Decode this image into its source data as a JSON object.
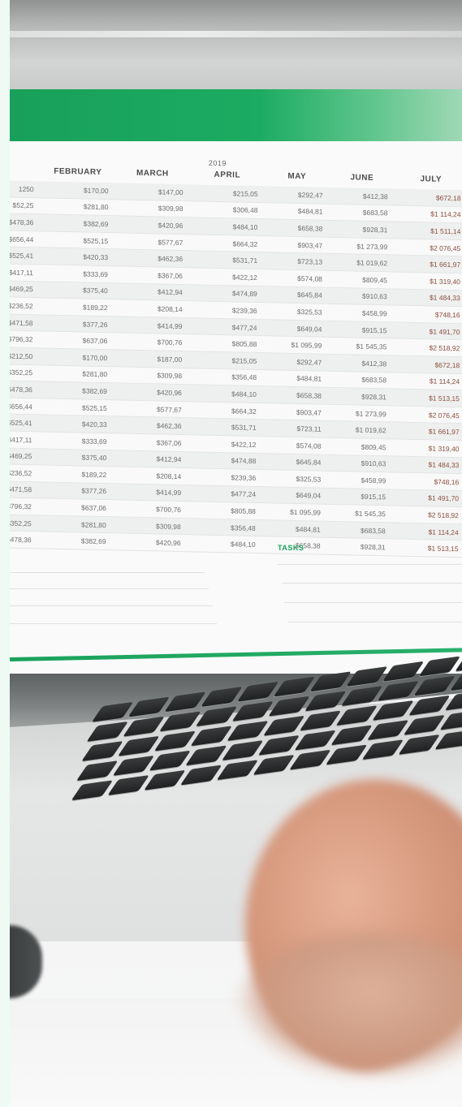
{
  "spreadsheet": {
    "year": "2019",
    "months": [
      "FEBRUARY",
      "MARCH",
      "APRIL",
      "MAY",
      "JUNE",
      "JULY"
    ],
    "rows": [
      [
        "1250",
        "$170,00",
        "$147,00",
        "$215,05",
        "$292,47",
        "$412,38",
        "$672,18"
      ],
      [
        "$52,25",
        "$281,80",
        "$309,98",
        "$306,48",
        "$484,81",
        "$683,58",
        "$1 114,24"
      ],
      [
        "$478,36",
        "$382,69",
        "$420,96",
        "$484,10",
        "$658,38",
        "$928,31",
        "$1 511,14"
      ],
      [
        "$656,44",
        "$525,15",
        "$577,67",
        "$664,32",
        "$903,47",
        "$1 273,99",
        "$2 076,45"
      ],
      [
        "$525,41",
        "$420,33",
        "$462,36",
        "$531,71",
        "$723,13",
        "$1 019,62",
        "$1 661,97"
      ],
      [
        "$417,11",
        "$333,69",
        "$367,06",
        "$422,12",
        "$574,08",
        "$809,45",
        "$1 319,40"
      ],
      [
        "$469,25",
        "$375,40",
        "$412,94",
        "$474,89",
        "$645,84",
        "$910,63",
        "$1 484,33"
      ],
      [
        "$236,52",
        "$189,22",
        "$208,14",
        "$239,36",
        "$325,53",
        "$458,99",
        "$748,16"
      ],
      [
        "$471,58",
        "$377,26",
        "$414,99",
        "$477,24",
        "$649,04",
        "$915,15",
        "$1 491,70"
      ],
      [
        "$796,32",
        "$637,06",
        "$700,76",
        "$805,88",
        "$1 095,99",
        "$1 545,35",
        "$2 518,92"
      ],
      [
        "$212,50",
        "$170,00",
        "$187,00",
        "$215,05",
        "$292,47",
        "$412,38",
        "$672,18"
      ],
      [
        "$352,25",
        "$281,80",
        "$309,98",
        "$356,48",
        "$484,81",
        "$683,58",
        "$1 114,24"
      ],
      [
        "$478,36",
        "$382,69",
        "$420,96",
        "$484,10",
        "$658,38",
        "$928,31",
        "$1 513,15"
      ],
      [
        "$656,44",
        "$525,15",
        "$577,67",
        "$664,32",
        "$903,47",
        "$1 273,99",
        "$2 076,45"
      ],
      [
        "$525,41",
        "$420,33",
        "$462,36",
        "$531,71",
        "$723,11",
        "$1 019,62",
        "$1 661,97"
      ],
      [
        "$417,11",
        "$333,69",
        "$367,06",
        "$422,12",
        "$574,08",
        "$809,45",
        "$1 319,40"
      ],
      [
        "$469,25",
        "$375,40",
        "$412,94",
        "$474,88",
        "$645,84",
        "$910,63",
        "$1 484,33"
      ],
      [
        "$236,52",
        "$189,22",
        "$208,14",
        "$239,36",
        "$325,53",
        "$458,99",
        "$748,16"
      ],
      [
        "$471,58",
        "$377,26",
        "$414,99",
        "$477,24",
        "$649,04",
        "$915,15",
        "$1 491,70"
      ],
      [
        "$796,32",
        "$637,06",
        "$700,76",
        "$805,88",
        "$1 095,99",
        "$1 545,35",
        "$2 518,92"
      ],
      [
        "$352,25",
        "$281,80",
        "$309,98",
        "$356,48",
        "$484,81",
        "$683,58",
        "$1 114,24"
      ],
      [
        "$478,36",
        "$382,69",
        "$420,96",
        "$484,10",
        "$658,38",
        "$928,31",
        "$1 513,15"
      ]
    ],
    "tasks_label": "TASKS"
  },
  "colors": {
    "header_green": "#1aa25c",
    "tasks_green": "#1aa25c",
    "july_text": "#8b4d3d",
    "page_bg": "#eefaf3"
  }
}
